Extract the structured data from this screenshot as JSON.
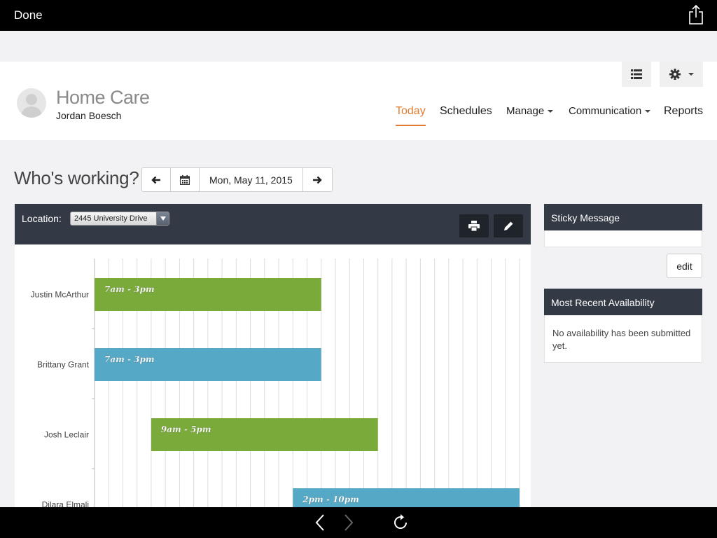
{
  "browser": {
    "done_label": "Done",
    "share_icon": "share-icon",
    "back_icon": "chevron-left-icon",
    "forward_icon": "chevron-right-icon",
    "reload_icon": "reload-icon"
  },
  "header": {
    "brand": "Home Care",
    "user_name": "Jordan Boesch",
    "nav": [
      {
        "label": "Today",
        "active": true,
        "dropdown": false
      },
      {
        "label": "Schedules",
        "active": false,
        "dropdown": false
      },
      {
        "label": "Manage",
        "active": false,
        "dropdown": true
      },
      {
        "label": "Communication",
        "active": false,
        "dropdown": true
      },
      {
        "label": "Reports",
        "active": false,
        "dropdown": false
      }
    ]
  },
  "datebar": {
    "title": "Who's working?",
    "date": "Mon, May 11, 2015"
  },
  "schedule": {
    "location_label": "Location:",
    "location_value": "2445 University Drive",
    "shifts": [
      {
        "name": "Justin McArthur",
        "label": "7am - 3pm",
        "start": 7,
        "end": 15,
        "color": "#7aab3a"
      },
      {
        "name": "Brittany Grant",
        "label": "7am - 3pm",
        "start": 7,
        "end": 15,
        "color": "#55a9c6"
      },
      {
        "name": "Josh Leclair",
        "label": "9am - 5pm",
        "start": 9,
        "end": 17,
        "color": "#7aab3a"
      },
      {
        "name": "Dilara Elmali",
        "label": "2pm - 10pm",
        "start": 14,
        "end": 22,
        "color": "#55a9c6"
      }
    ],
    "hour_range": [
      7,
      22
    ]
  },
  "sidebar": {
    "sticky_title": "Sticky Message",
    "edit_label": "edit",
    "availability_title": "Most Recent Availability",
    "availability_text": "No availability has been submitted yet."
  },
  "colors": {
    "accent": "#e07b30",
    "panel_header": "#343a45",
    "green": "#7aab3a",
    "blue": "#55a9c6"
  }
}
